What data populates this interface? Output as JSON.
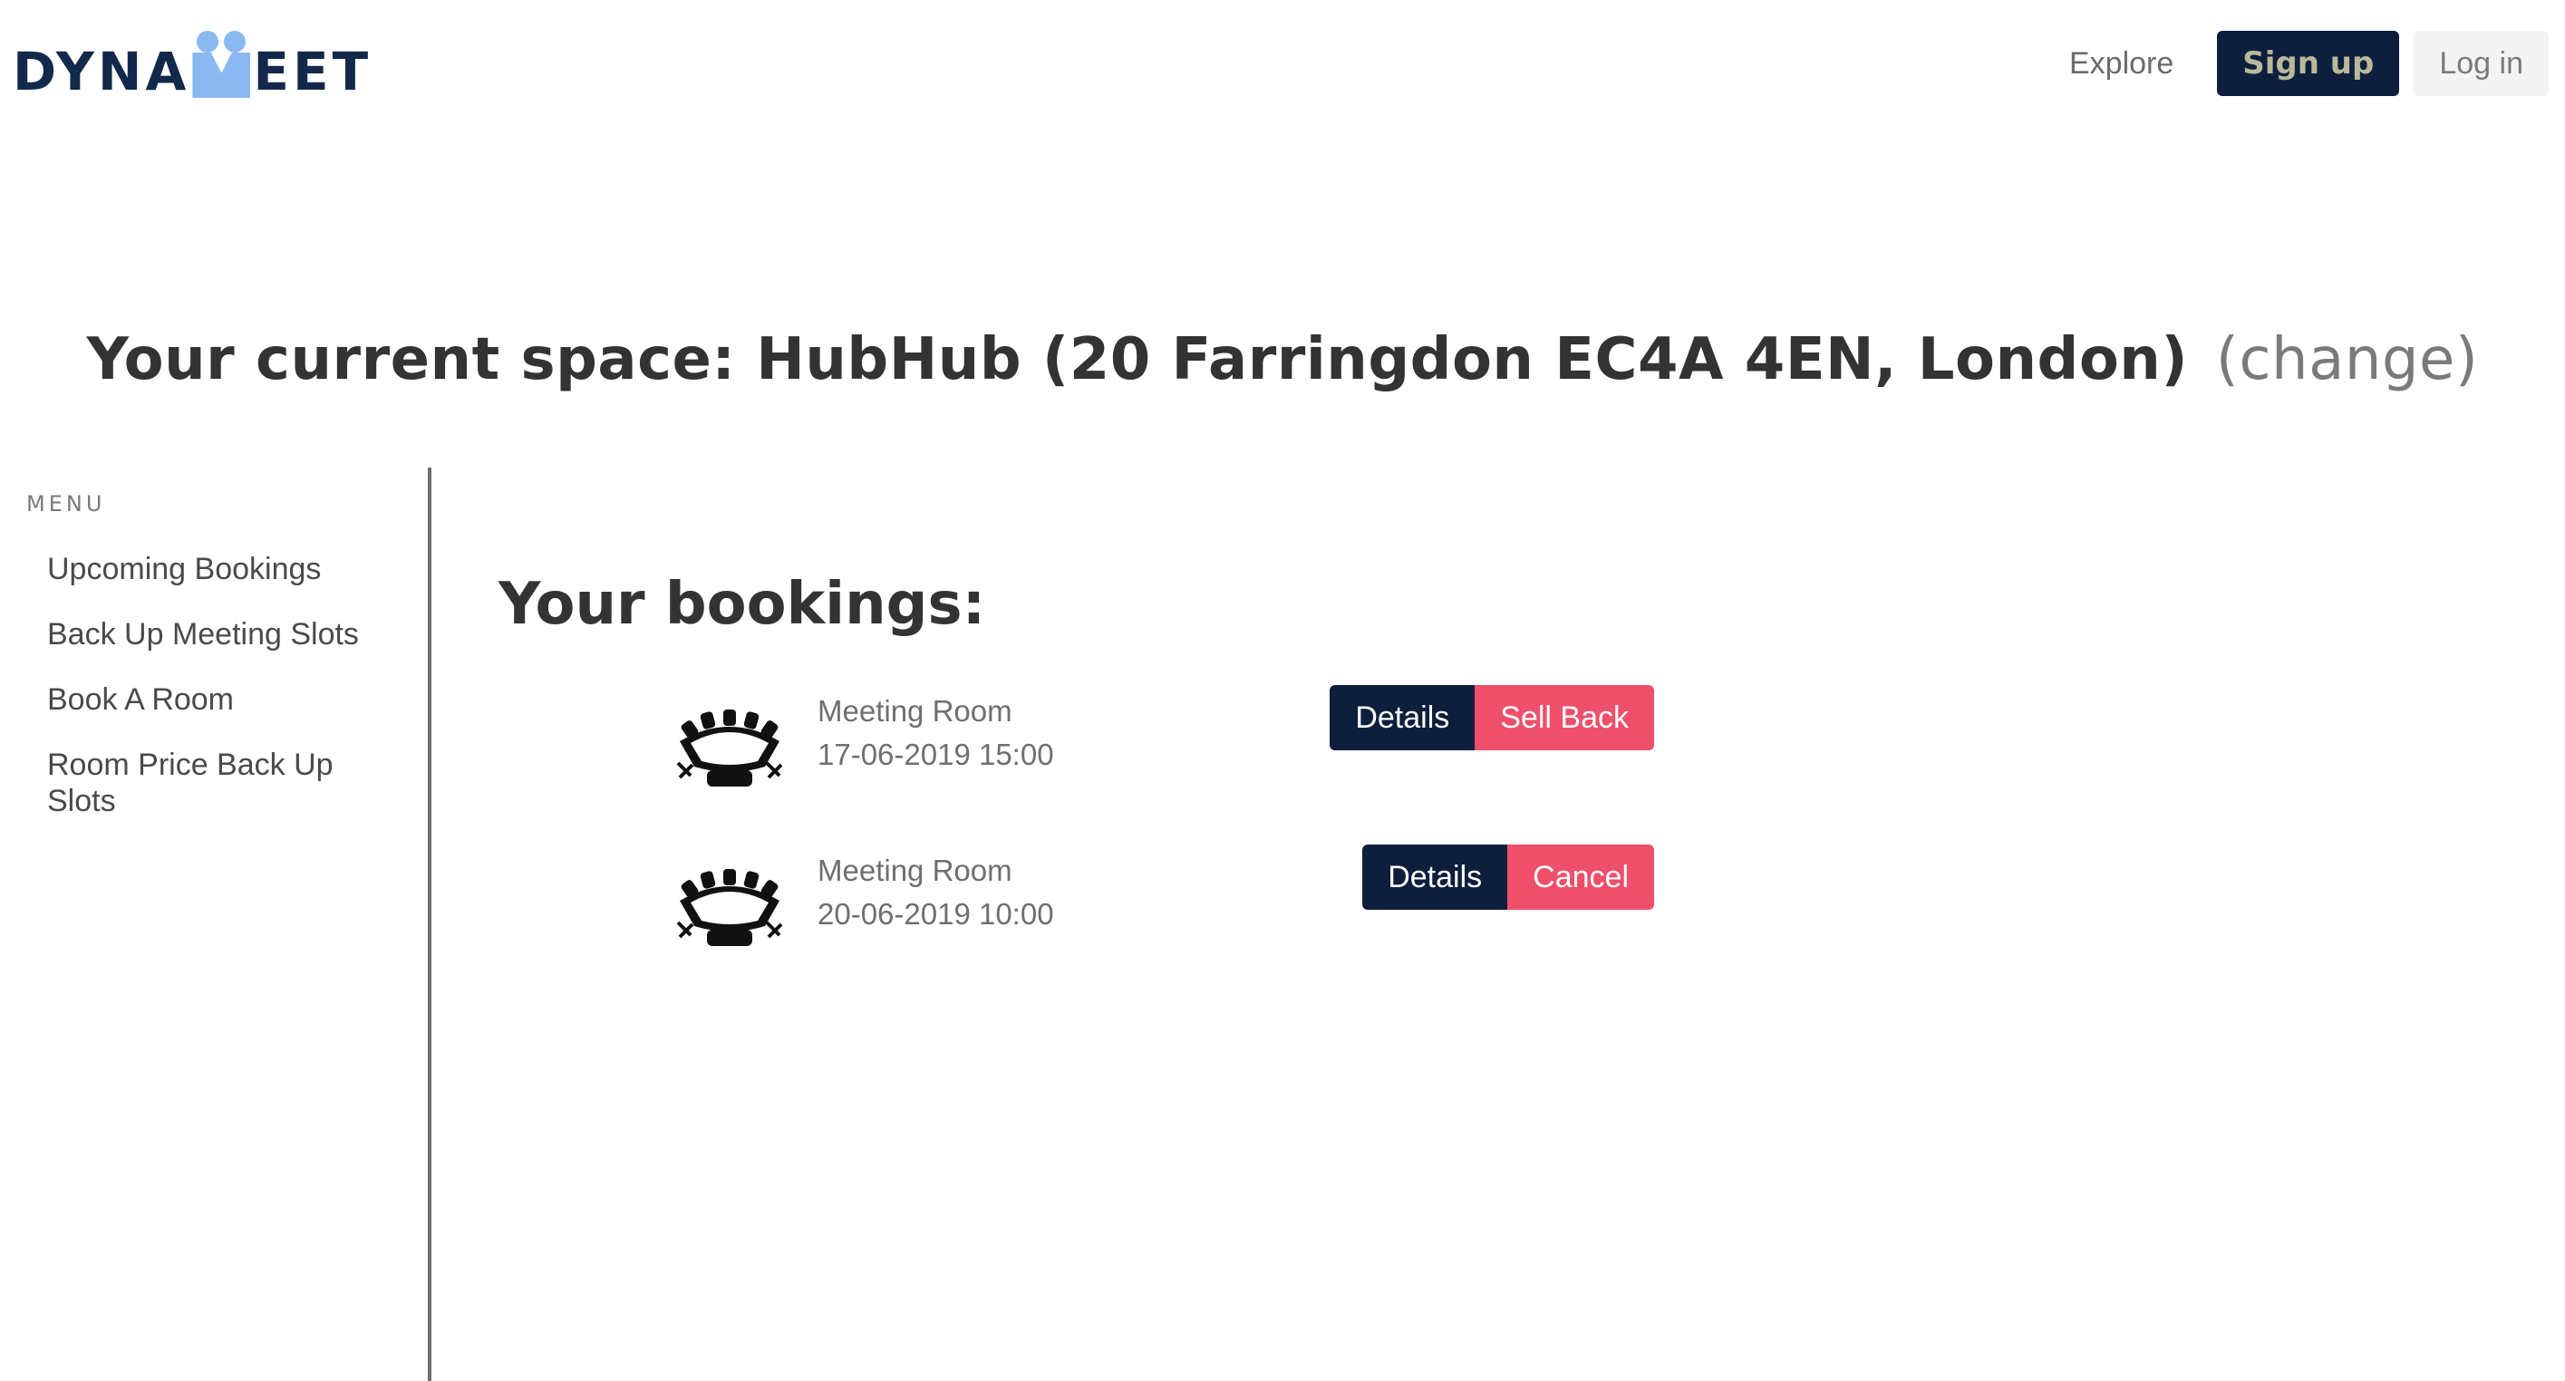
{
  "header": {
    "logo": {
      "text_left": "DYNA",
      "text_right": "EET"
    },
    "nav": {
      "explore": "Explore",
      "signup": "Sign up",
      "login": "Log in"
    }
  },
  "space": {
    "title": "Your current space: HubHub (20 Farringdon EC4A 4EN, London)",
    "change": "(change)"
  },
  "sidebar": {
    "menu_label": "MENU",
    "items": [
      {
        "label": "Upcoming Bookings"
      },
      {
        "label": "Back Up Meeting Slots"
      },
      {
        "label": "Book A Room"
      },
      {
        "label": "Room Price Back Up Slots"
      }
    ]
  },
  "main": {
    "heading": "Your bookings:",
    "bookings": [
      {
        "icon": "meeting-table-icon",
        "name": "Meeting Room",
        "datetime": "17-06-2019 15:00",
        "details_label": "Details",
        "action_label": "Sell Back"
      },
      {
        "icon": "meeting-table-icon",
        "name": "Meeting Room",
        "datetime": "20-06-2019 10:00",
        "details_label": "Details",
        "action_label": "Cancel"
      }
    ]
  },
  "colors": {
    "navy": "#0d1f3c",
    "danger": "#ee4f6b",
    "logo_blue": "#8ab8f1",
    "logo_dark": "#13294b"
  }
}
